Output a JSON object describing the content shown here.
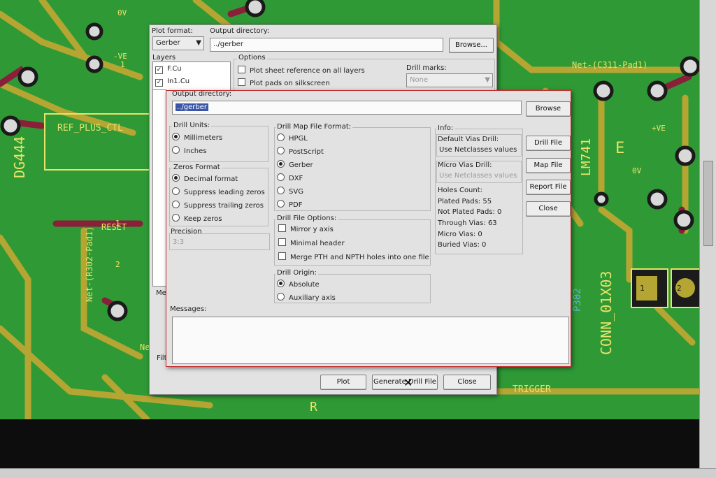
{
  "pcb": {
    "labels": [
      "0V",
      "-VE",
      "1",
      "REF_PLUS_CTL",
      "DG444",
      "RESET",
      "Net-(R302-Pad1)",
      "Net-(C311-Pad1)",
      "LM741",
      "+VE",
      "0V",
      "CONN_01X03",
      "P302",
      "TRIGGER",
      "R",
      "2",
      "1",
      "Ne",
      "1",
      "2",
      "E"
    ]
  },
  "plot_dialog": {
    "plot_format_label": "Plot format:",
    "plot_format_value": "Gerber",
    "output_dir_label": "Output directory:",
    "output_dir_value": "../gerber",
    "browse_label": "Browse...",
    "layers_label": "Layers",
    "layers": [
      "F.Cu",
      "In1.Cu"
    ],
    "options_label": "Options",
    "opt_sheet_ref": "Plot sheet reference on all layers",
    "opt_pads_silk": "Plot pads on silkscreen",
    "drill_marks_label": "Drill marks:",
    "drill_marks_value": "None",
    "messages_partial": "Me",
    "filter_partial": "Filt",
    "plot_button": "Plot",
    "generate_drill_button": "Generate Drill File",
    "close_button": "Close"
  },
  "drill_dialog": {
    "output_dir_label": "Output directory:",
    "output_dir_value": "../gerber",
    "browse_label": "Browse",
    "drill_units_label": "Drill Units:",
    "units": [
      "Millimeters",
      "Inches"
    ],
    "zeros_format_label": "Zeros Format",
    "zeros": [
      "Decimal format",
      "Suppress leading zeros",
      "Suppress trailing zeros",
      "Keep zeros"
    ],
    "precision_label": "Precision",
    "precision_value": "3:3",
    "map_format_label": "Drill Map File Format:",
    "map_formats": [
      "HPGL",
      "PostScript",
      "Gerber",
      "DXF",
      "SVG",
      "PDF"
    ],
    "drill_file_options_label": "Drill File Options:",
    "file_options": [
      "Mirror y axis",
      "Minimal header",
      "Merge PTH and NPTH holes into one file"
    ],
    "drill_origin_label": "Drill Origin:",
    "origins": [
      "Absolute",
      "Auxiliary axis"
    ],
    "info_label": "Info:",
    "default_vias_label": "Default Vias Drill:",
    "default_vias_value": "Use Netclasses values",
    "micro_vias_label": "Micro Vias Drill:",
    "micro_vias_value": "Use Netclasses values",
    "holes_count_label": "Holes Count:",
    "holes": [
      "Plated Pads: 55",
      "Not Plated Pads: 0",
      "Through Vias: 63",
      "Micro Vias: 0",
      "Buried Vias: 0"
    ],
    "drill_file_button": "Drill File",
    "map_file_button": "Map File",
    "report_file_button": "Report File",
    "close_button": "Close",
    "messages_label": "Messages:"
  }
}
